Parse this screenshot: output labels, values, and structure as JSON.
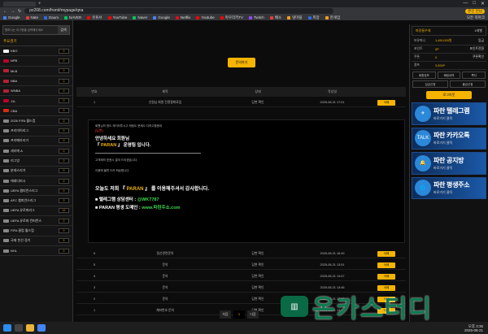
{
  "browser": {
    "url": "pz268.com/front#mypage/qna",
    "profile": "본인 만남",
    "bookmarks": [
      {
        "label": "Google",
        "color": "#4285f4"
      },
      {
        "label": "Nate",
        "color": "#e83a3a"
      },
      {
        "label": "Daum",
        "color": "#2d6ae0"
      },
      {
        "label": "NAVER",
        "color": "#03c75a"
      },
      {
        "label": "유튜브",
        "color": "#ff0000"
      },
      {
        "label": "YouTube",
        "color": "#ff0000"
      },
      {
        "label": "Naver",
        "color": "#03c75a"
      },
      {
        "label": "Google",
        "color": "#4285f4"
      },
      {
        "label": "Netflix",
        "color": "#e50914"
      },
      {
        "label": "Youtube",
        "color": "#ff0000"
      },
      {
        "label": "마우리키TV",
        "color": "#ff0000"
      },
      {
        "label": "Twitch",
        "color": "#9146ff"
      },
      {
        "label": "배소",
        "color": "#e83a3a"
      },
      {
        "label": "넷마블",
        "color": "#ff9f1a"
      },
      {
        "label": "피망",
        "color": "#2d6ae0"
      },
      {
        "label": "한게임",
        "color": "#ff9f1a"
      }
    ],
    "all_bookmarks": "모든 북마크"
  },
  "left": {
    "search_placeholder": "원하시는 리그명을 입력해주세요",
    "search_btn": "검색",
    "section": "주요경기",
    "leagues": [
      {
        "name": "KBO",
        "count": "0",
        "color": "#fff"
      },
      {
        "name": "NPB",
        "count": "0",
        "color": "#bc002d"
      },
      {
        "name": "MLB",
        "count": "0",
        "color": "#b22234"
      },
      {
        "name": "NBA",
        "count": "0",
        "color": "#b22234"
      },
      {
        "name": "WNBA",
        "count": "0",
        "color": "#b22234"
      },
      {
        "name": "J1L",
        "count": "0",
        "color": "#bc002d"
      },
      {
        "name": "CBA",
        "count": "0",
        "color": "#de2910"
      },
      {
        "name": "2026 FIFA 월드컵",
        "count": "0",
        "color": "#888"
      },
      {
        "name": "프리미어리그",
        "count": "0",
        "color": "#888"
      },
      {
        "name": "프리메라리가",
        "count": "0",
        "color": "#888"
      },
      {
        "name": "세리에 A",
        "count": "0",
        "color": "#888"
      },
      {
        "name": "리그앙",
        "count": "0",
        "color": "#888"
      },
      {
        "name": "분데스리가",
        "count": "0",
        "color": "#888"
      },
      {
        "name": "에레디비시",
        "count": "0",
        "color": "#888"
      },
      {
        "name": "UEFA 챔피언스리그",
        "count": "0",
        "color": "#888"
      },
      {
        "name": "AFC 챔피언스리그",
        "count": "0",
        "color": "#888"
      },
      {
        "name": "UEFA 유로파리그",
        "count": "12",
        "color": "#888"
      },
      {
        "name": "UEFA 유로파 컨퍼런스",
        "count": "0",
        "color": "#888"
      },
      {
        "name": "FIFA 클럽 월드컵",
        "count": "0",
        "color": "#888"
      },
      {
        "name": "국제 친선 경기",
        "count": "5",
        "color": "#888"
      },
      {
        "name": "NHL",
        "count": "0",
        "color": "#888"
      }
    ]
  },
  "main": {
    "write_btn": "문의하기",
    "headers": [
      "번호",
      "제목",
      "상태",
      "작성일",
      ""
    ],
    "first_row": {
      "no": "1",
      "title": "신원님 회원 진명필화료입",
      "status": "답변 확인",
      "date": "2025-08-21 17:01",
      "btn": "삭제"
    },
    "detail": {
      "p1": "회원님의 정도 케이터투시고 케팅도 문제으 다하고합동대",
      "red": "[답변]",
      "h1": "안녕하세요 회원님",
      "h2a": "『 ",
      "h2b": "PARAN",
      "h2c": " 』 운영팀 입니다.",
      "p2": "고객제의 표현시 결국 드리겠습니다.",
      "p3": "이용에 불편 드려 죄송합니다",
      "big_a": "오늘도 저희 『 ",
      "big_b": "PARAN",
      "big_c": " 』 를 이용해주셔서 감사합니다.",
      "tg_a": "■ 텔레그램 상담센터 : ",
      "tg_b": "@WK7787",
      "dom_a": "■ PARAN 평생 도메인 : ",
      "dom_b": "www.파란주소.com"
    },
    "rows": [
      {
        "no": "6",
        "title": "정산관련문의",
        "status": "답변 확인",
        "date": "2025-08-21 16:49",
        "btn": "삭제"
      },
      {
        "no": "5",
        "title": "문의",
        "status": "답변 확인",
        "date": "2025-08-21 13:51",
        "btn": "삭제"
      },
      {
        "no": "4",
        "title": "문의",
        "status": "답변 확인",
        "date": "2025-08-21 13:47",
        "btn": "삭제"
      },
      {
        "no": "3",
        "title": "문의",
        "status": "답변 확인",
        "date": "2025-08-21 13:46",
        "btn": "삭제"
      },
      {
        "no": "2",
        "title": "문의",
        "status": "답변 확인",
        "date": "2025-08-21 13:44",
        "btn": "삭제"
      },
      {
        "no": "1",
        "title": "계좌번호 문의",
        "status": "답변 확인",
        "date": "2025-08-21 13:31",
        "btn": "삭제"
      }
    ],
    "pager": [
      "처음",
      "1",
      "다음"
    ]
  },
  "right": {
    "user": "파랑들우데",
    "level": "1레벨",
    "rows": [
      {
        "k": "보유머니",
        "v": "1,490,000원",
        "x": "입금"
      },
      {
        "k": "포인트",
        "v": "0P",
        "x": "포인트전환"
      },
      {
        "k": "쿠폰",
        "v": "0",
        "x": "쿠폰확인"
      },
      {
        "k": "콤프",
        "v": "3,000P",
        "x": ""
      }
    ],
    "btns1": [
      "회원정보",
      "베팅내역",
      "쪽지"
    ],
    "btns2": [
      "입금신청",
      "출금신청"
    ],
    "logout": "로그아웃",
    "banners": [
      {
        "t1": "파란 텔레그램",
        "t2": "바로가기 클릭",
        "icon": "✈"
      },
      {
        "t1": "파란 카카오톡",
        "t2": "바로가기 클릭",
        "icon": "TALK"
      },
      {
        "t1": "파란 공지방",
        "t2": "바로가기 클릭",
        "icon": "🔔"
      },
      {
        "t1": "파란 평생주소",
        "t2": "바로가기 클릭",
        "icon": "🌐"
      }
    ]
  },
  "watermark": "온카스터디",
  "taskbar": {
    "time": "오후 3:35",
    "date": "2025-08-21"
  }
}
